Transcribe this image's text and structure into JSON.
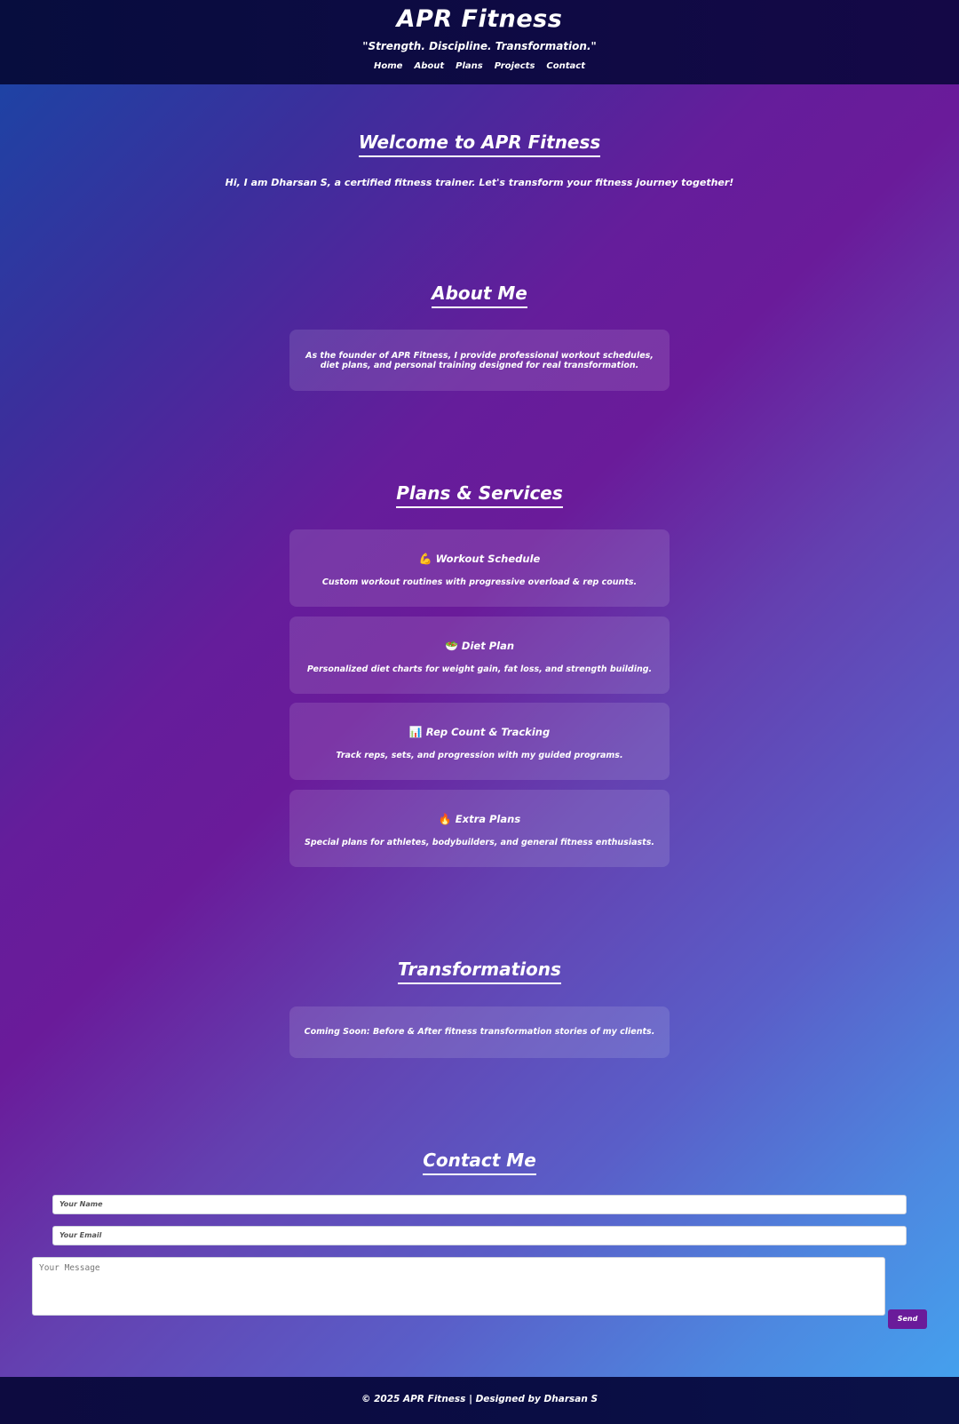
{
  "header": {
    "brand": "APR Fitness",
    "tagline": "\"Strength. Discipline. Transformation.\"",
    "nav": [
      "Home",
      "About",
      "Plans",
      "Projects",
      "Contact"
    ]
  },
  "hero": {
    "title": "Welcome to APR Fitness",
    "text": "Hi, I am Dharsan S, a certified fitness trainer. Let's transform your fitness journey together!"
  },
  "about": {
    "title": "About Me",
    "text": "As the founder of APR Fitness, I provide professional workout schedules, diet plans, and personal training designed for real transformation."
  },
  "plans": {
    "title": "Plans & Services",
    "items": [
      {
        "icon": "💪",
        "icon_name": "flexed-biceps-icon",
        "title": "Workout Schedule",
        "desc": "Custom workout routines with progressive overload & rep counts."
      },
      {
        "icon": "🥗",
        "icon_name": "salad-bowl-icon",
        "title": "Diet Plan",
        "desc": "Personalized diet charts for weight gain, fat loss, and strength building."
      },
      {
        "icon": "📊",
        "icon_name": "bar-chart-icon",
        "title": "Rep Count & Tracking",
        "desc": "Track reps, sets, and progression with my guided programs."
      },
      {
        "icon": "🔥",
        "icon_name": "fire-icon",
        "title": "Extra Plans",
        "desc": "Special plans for athletes, bodybuilders, and general fitness enthusiasts."
      }
    ]
  },
  "transformations": {
    "title": "Transformations",
    "text": "Coming Soon: Before & After fitness transformation stories of my clients."
  },
  "contact": {
    "title": "Contact Me",
    "name_placeholder": "Your Name",
    "email_placeholder": "Your Email",
    "message_placeholder": "Your Message",
    "send_label": "Send"
  },
  "footer": {
    "text": "© 2025 APR Fitness | Designed by Dharsan S"
  },
  "colors": {
    "header_bg": "#0b0b42",
    "accent": "#6a1b9a",
    "gradient_start": "#1747a6",
    "gradient_end": "#43a5f0"
  }
}
